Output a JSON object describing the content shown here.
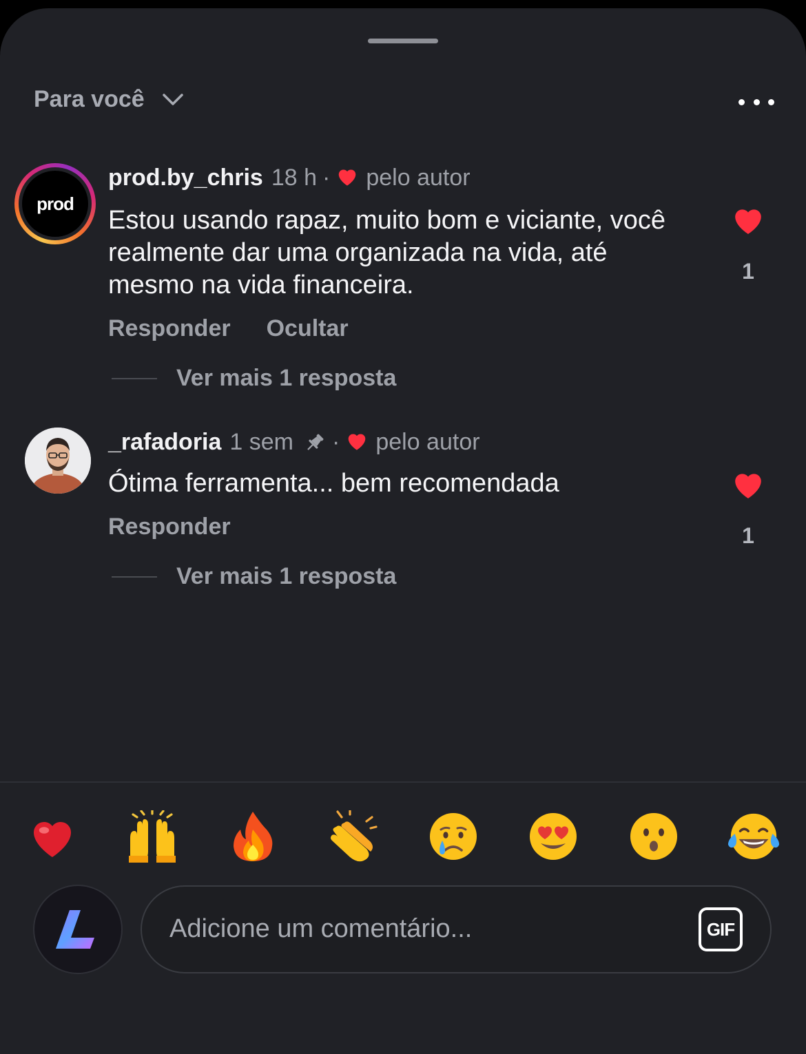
{
  "header": {
    "filter_label": "Para você"
  },
  "comments": [
    {
      "username": "prod.by_chris",
      "time": "18 h",
      "liked_by_author_label": "pelo autor",
      "avatar_text": "prod",
      "text": "Estou usando rapaz, muito bom e viciante, você realmente dar uma organizada na vida, até mesmo na vida financeira.",
      "actions": [
        "Responder",
        "Ocultar"
      ],
      "more_replies": "Ver mais 1 resposta",
      "likes": "1"
    },
    {
      "username": "_rafadoria",
      "time": "1 sem",
      "liked_by_author_label": "pelo autor",
      "text": "Ótima ferramenta... bem recomendada",
      "actions": [
        "Responder"
      ],
      "more_replies": "Ver mais 1 resposta",
      "likes": "1"
    }
  ],
  "quick_reactions": [
    "❤️",
    "🙌",
    "🔥",
    "👏",
    "😢",
    "😍",
    "😮",
    "😂"
  ],
  "composer": {
    "placeholder": "Adicione um comentário...",
    "gif_label": "GIF"
  },
  "colors": {
    "background": "#202126",
    "like_red": "#ff3040",
    "muted_text": "#9ea1a8"
  }
}
